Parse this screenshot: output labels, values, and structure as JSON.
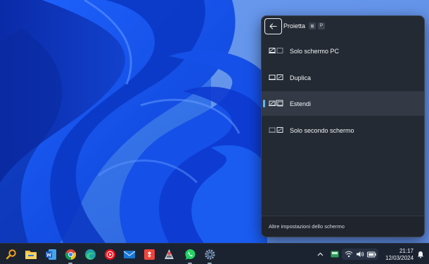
{
  "flyout": {
    "title": "Proietta",
    "shortcut_win": "⊞",
    "shortcut_key": "P",
    "options": [
      {
        "label": "Solo schermo PC",
        "selected": false
      },
      {
        "label": "Duplica",
        "selected": false
      },
      {
        "label": "Estendi",
        "selected": true
      },
      {
        "label": "Solo secondo schermo",
        "selected": false
      }
    ],
    "footer_link": "Altre impostazioni dello schermo"
  },
  "taskbar": {
    "apps": [
      "search-icon",
      "file-explorer-icon",
      "word-icon",
      "chrome-icon",
      "edge-icon",
      "youtube-music-icon",
      "mail-icon",
      "anydesk-icon",
      "app-icon",
      "whatsapp-icon",
      "settings-icon"
    ],
    "time": "21:17",
    "date": "12/03/2024"
  },
  "colors": {
    "accent": "#61b5f5",
    "flyout_bg": "#242a33",
    "taskbar_bg": "#1b2331"
  }
}
